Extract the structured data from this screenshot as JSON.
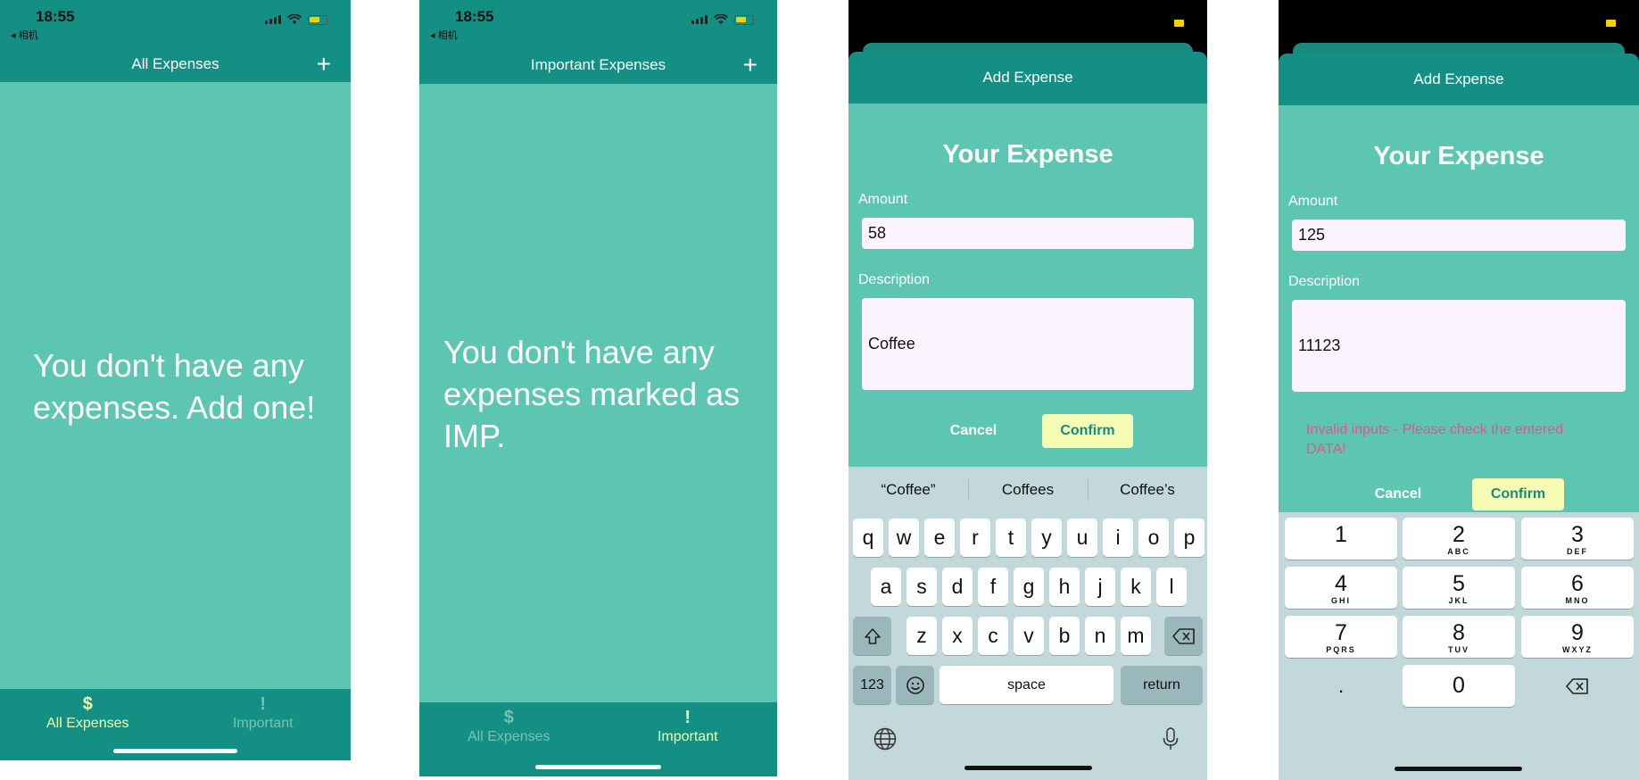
{
  "status": {
    "time": "18:55",
    "back_app": "◂ 相机"
  },
  "screen1": {
    "title": "All Expenses",
    "add_icon": "+",
    "empty_line1": "You don't have any",
    "empty_line2": "expenses. Add one!",
    "tabs": [
      {
        "icon": "$",
        "label": "All Expenses",
        "active": true
      },
      {
        "icon": "!",
        "label": "Important",
        "active": false
      }
    ]
  },
  "screen2": {
    "title": "Important Expenses",
    "add_icon": "+",
    "empty_line1": "You don't have any",
    "empty_line2": "expenses marked as",
    "empty_line3": "IMP.",
    "tabs": [
      {
        "icon": "$",
        "label": "All Expenses",
        "active": false
      },
      {
        "icon": "!",
        "label": "Important",
        "active": true
      }
    ]
  },
  "screen3": {
    "modal_title": "Add Expense",
    "heading": "Your Expense",
    "amount_label": "Amount",
    "amount_value": "58",
    "description_label": "Description",
    "description_value": "Coffee",
    "cancel_label": "Cancel",
    "confirm_label": "Confirm",
    "suggestions": [
      "“Coffee”",
      "Coffees",
      "Coffee’s"
    ],
    "keyboard": {
      "row1": [
        "q",
        "w",
        "e",
        "r",
        "t",
        "y",
        "u",
        "i",
        "o",
        "p"
      ],
      "row2": [
        "a",
        "s",
        "d",
        "f",
        "g",
        "h",
        "j",
        "k",
        "l"
      ],
      "row3": [
        "z",
        "x",
        "c",
        "v",
        "b",
        "n",
        "m"
      ],
      "numbers_key": "123",
      "space_key": "space",
      "return_key": "return"
    }
  },
  "screen4": {
    "modal_title": "Add Expense",
    "heading": "Your Expense",
    "amount_label": "Amount",
    "amount_value": "125",
    "description_label": "Description",
    "description_value": "11123",
    "error_line1": "Invalid inputs - Please check the entered",
    "error_line2": "DATA!",
    "cancel_label": "Cancel",
    "confirm_label": "Confirm",
    "numpad": [
      {
        "d": "1",
        "s": ""
      },
      {
        "d": "2",
        "s": "ABC"
      },
      {
        "d": "3",
        "s": "DEF"
      },
      {
        "d": "4",
        "s": "GHI"
      },
      {
        "d": "5",
        "s": "JKL"
      },
      {
        "d": "6",
        "s": "MNO"
      },
      {
        "d": "7",
        "s": "PQRS"
      },
      {
        "d": "8",
        "s": "TUV"
      },
      {
        "d": "9",
        "s": "WXYZ"
      }
    ],
    "decimal_key": ".",
    "zero_key": "0"
  },
  "colors": {
    "header": "#148f84",
    "body": "#5dc6b3",
    "confirm_bg": "#f6fcb4",
    "active_tab": "#eaffb0",
    "error": "#e0558a"
  },
  "icons": {
    "add": "plus-icon",
    "dollar": "dollar-icon",
    "important": "exclamation-icon",
    "shift": "shift-icon",
    "delete": "backspace-icon",
    "emoji": "emoji-icon",
    "globe": "globe-icon",
    "mic": "microphone-icon"
  }
}
